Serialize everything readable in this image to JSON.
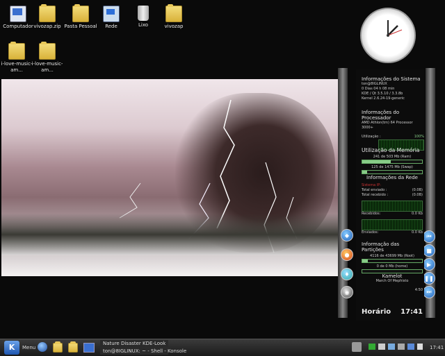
{
  "desktop": {
    "icons": [
      {
        "label": "Computador"
      },
      {
        "label": "vivozap.zip"
      },
      {
        "label": "Pasta Pessoal"
      },
      {
        "label": "Rede"
      },
      {
        "label": "Lixo"
      },
      {
        "label": "vivozap"
      },
      {
        "label": "i-love-music-am..."
      },
      {
        "label": "i-love-music-am..."
      }
    ]
  },
  "sysmon": {
    "sys_title": "Informações do Sistema",
    "user": "ton@8IGLINUX",
    "uptime": "0 Dias 04 h 08 min",
    "kde_qt": "KDE / Qt    3.5.10 / 3.3.8b",
    "kernel": "Kernel 2.6.24-19-generic",
    "cpu_title": "Informações do Processador",
    "cpu_name": "AMD Athlon(tm) 64 Processor 3000+",
    "cpu_use_label": "Utilização :",
    "cpu_use_value": "100%",
    "mem_title": "Utilização da Memória",
    "ram_text": "241   de   503 Mb (Ram)",
    "swap_text": "125   de  1475 Mb (Swap)",
    "ram_fraction": 0.48,
    "swap_fraction": 0.08,
    "net_title": "Informações da Rede",
    "net_iface": "Sistema IP:",
    "total_sent_label": "Total enviado :",
    "total_sent_value": "(0.0B)",
    "total_recv_label": "Total recebido :",
    "total_recv_value": "(0.0B)",
    "recv_label": "Recebidos:",
    "recv_value": "0.0 Kb",
    "sent_label": "Enviados:",
    "sent_value": "0.0 Kb",
    "part_title": "Informação das Partições",
    "root_text": "4116   de   43699 Mb (Root)",
    "home_text": "0   de   0 Mb (home)",
    "root_fraction": 0.09,
    "home_fraction": 0.0,
    "song_artist": "Kamelot",
    "song_title": "March Of Mephisto",
    "song_time": "4:50",
    "time_label": "Horário",
    "time_value": "17:41"
  },
  "taskbar": {
    "menu_label": "Menu",
    "task1": "Nature Disaster KDE-Look",
    "task2": "ton@8IGLINUX: ~ - Shell - Konsole",
    "clock": "17:41"
  },
  "colors": {
    "accent": "#8c8",
    "warning": "#cc3333"
  }
}
